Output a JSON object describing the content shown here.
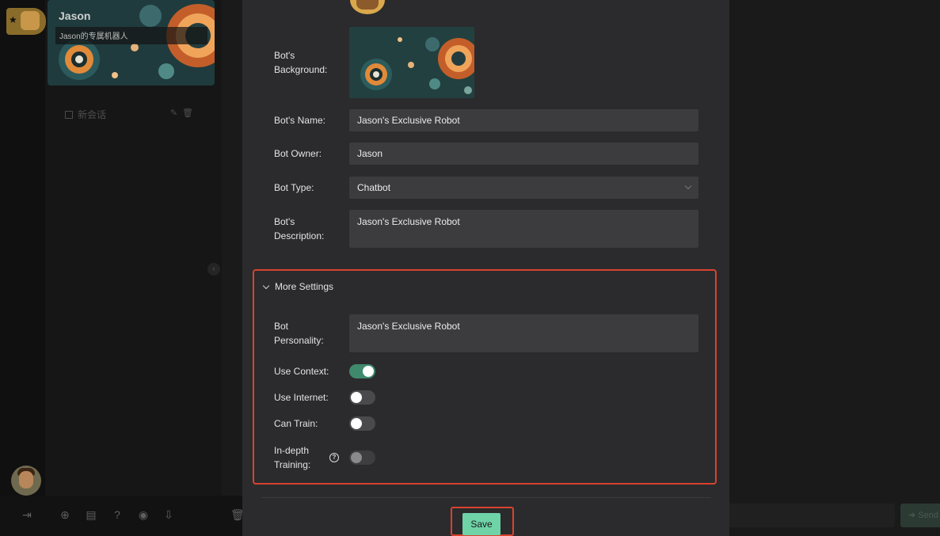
{
  "sidebar": {
    "bot_name": "Jason",
    "bot_subtitle": "Jason的专属机器人",
    "new_chat_label": "新会话"
  },
  "chat": {
    "send_label": "Send"
  },
  "form": {
    "background_label": "Bot's\nBackground:",
    "name_label": "Bot's Name:",
    "name_value": "Jason's Exclusive Robot",
    "owner_label": "Bot Owner:",
    "owner_value": "Jason",
    "type_label": "Bot Type:",
    "type_value": "Chatbot",
    "description_label": "Bot's\nDescription:",
    "description_value": "Jason's Exclusive Robot"
  },
  "more_settings": {
    "title": "More Settings",
    "personality_label": "Bot\nPersonality:",
    "personality_value": "Jason's Exclusive Robot",
    "use_context_label": "Use Context:",
    "use_context": true,
    "use_internet_label": "Use Internet:",
    "use_internet": false,
    "can_train_label": "Can Train:",
    "can_train": false,
    "indepth_label": "In-depth\nTraining:",
    "indepth": false
  },
  "actions": {
    "save_label": "Save"
  },
  "colors": {
    "accent_green": "#6fd3a8",
    "toggle_on": "#3f8a6d",
    "highlight_red": "#d8432f"
  },
  "icons": [
    "star-icon",
    "robot-avatar-icon",
    "chat-icon",
    "edit-icon",
    "delete-icon",
    "chevron-left-icon",
    "logout-icon",
    "add-icon",
    "document-icon",
    "help-icon",
    "camera-icon",
    "download-icon",
    "trash-icon",
    "send-arrow-icon",
    "chevron-down-icon",
    "question-icon"
  ]
}
